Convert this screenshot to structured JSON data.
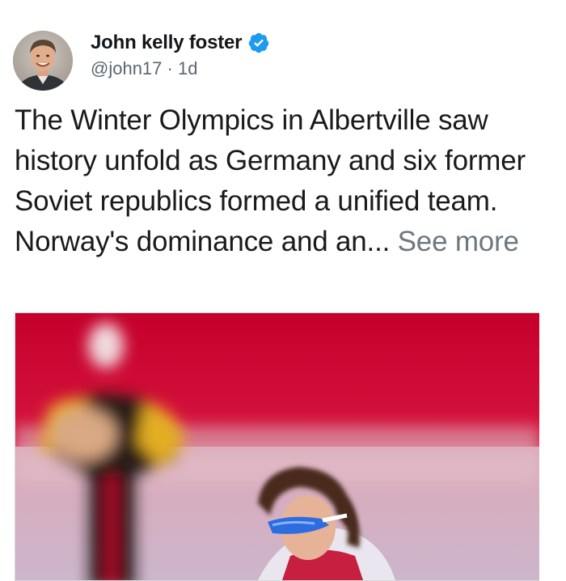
{
  "tweet": {
    "author": {
      "display_name": "John kelly foster",
      "handle": "@john17",
      "separator": " · ",
      "time": "1d",
      "verified": true,
      "avatar_icon": "profile-photo-icon",
      "verified_icon": "verified-badge-icon"
    },
    "text": "The Winter Olympics in Albertville saw history unfold as Germany and six former Soviet republics formed a unified team. Norway's dominance and an...",
    "see_more_label": "See more",
    "media": {
      "type": "photo",
      "icon": "speed-skating-photo"
    }
  },
  "colors": {
    "verified_blue": "#1d9bf0",
    "see_more_gray": "#6e7780",
    "handle_gray": "#5b6670"
  }
}
